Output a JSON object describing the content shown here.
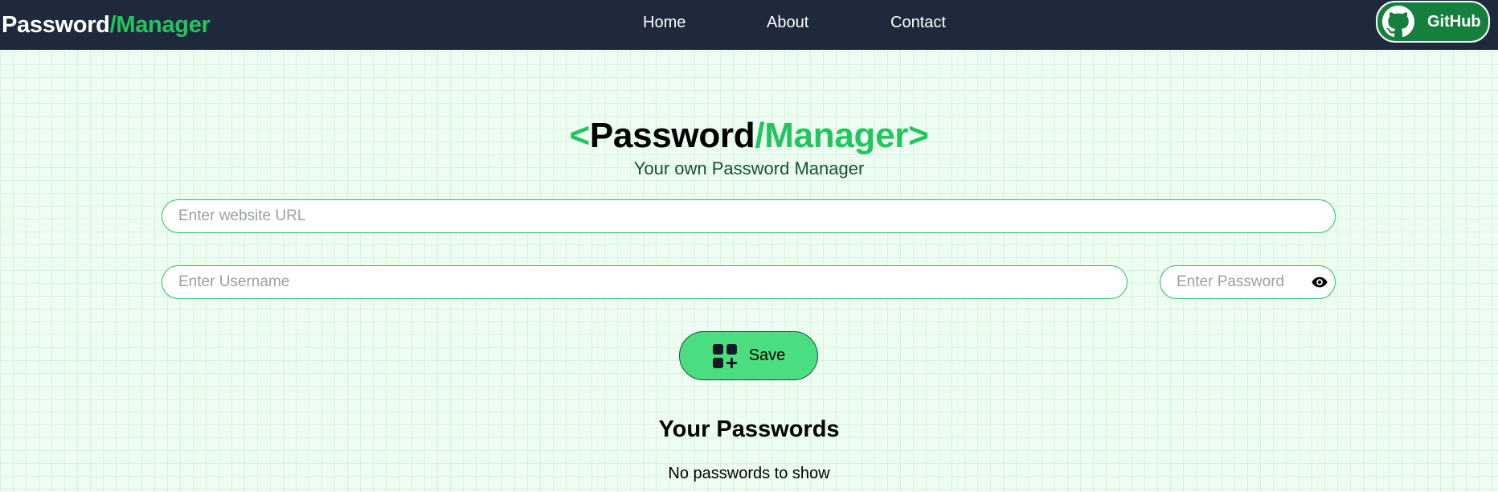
{
  "navbar": {
    "brand_main": "Password",
    "brand_accent": "/Manager",
    "links": {
      "home": "Home",
      "about": "About",
      "contact": "Contact"
    },
    "github_label": "GitHub",
    "github_icon": "github-icon"
  },
  "hero": {
    "bracket_open": "<",
    "title_main": "Password",
    "title_accent": "/Manager",
    "bracket_close": ">",
    "subtitle": "Your own Password Manager"
  },
  "form": {
    "url": {
      "placeholder": "Enter website URL",
      "value": ""
    },
    "username": {
      "placeholder": "Enter Username",
      "value": ""
    },
    "password": {
      "placeholder": "Enter Password",
      "value": ""
    },
    "show_password_icon": "eye-icon",
    "save_label": "Save",
    "save_icon": "grid-add-icon"
  },
  "passwords": {
    "title": "Your Passwords",
    "empty_message": "No passwords to show"
  },
  "colors": {
    "navbar_bg": "#1e293b",
    "accent_green": "#22c55e",
    "button_green": "#4ade80",
    "github_green": "#15803d",
    "page_bg": "#eefdf1"
  }
}
